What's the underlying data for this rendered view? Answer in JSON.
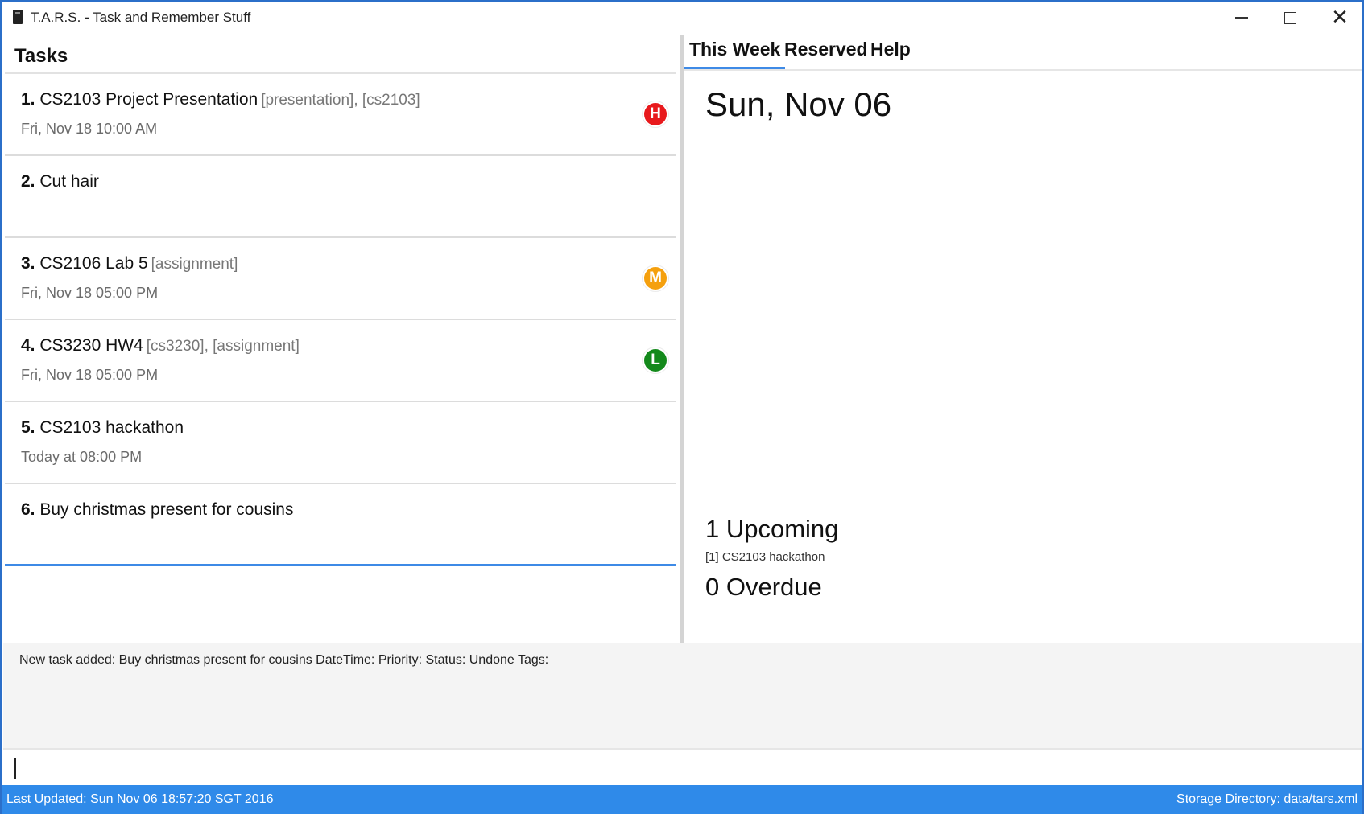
{
  "window": {
    "title": "T.A.R.S. - Task and Remember Stuff"
  },
  "tasks_panel": {
    "header": "Tasks",
    "tasks": [
      {
        "number": "1.",
        "name": "CS2103 Project Presentation",
        "tags": "[presentation], [cs2103]",
        "date": "Fri, Nov 18 10:00 AM",
        "priority": "H",
        "priority_color": "#e8191c"
      },
      {
        "number": "2.",
        "name": "Cut hair",
        "tags": "",
        "date": "",
        "priority": "",
        "priority_color": ""
      },
      {
        "number": "3.",
        "name": "CS2106 Lab 5",
        "tags": "[assignment]",
        "date": "Fri, Nov 18 05:00 PM",
        "priority": "M",
        "priority_color": "#f5a00e"
      },
      {
        "number": "4.",
        "name": "CS3230 HW4",
        "tags": "[cs3230], [assignment]",
        "date": "Fri, Nov 18 05:00 PM",
        "priority": "L",
        "priority_color": "#13891b"
      },
      {
        "number": "5.",
        "name": "CS2103 hackathon",
        "tags": "",
        "date": "Today at 08:00 PM",
        "priority": "",
        "priority_color": ""
      },
      {
        "number": "6.",
        "name": "Buy christmas present for cousins",
        "tags": "",
        "date": "",
        "priority": "",
        "priority_color": ""
      }
    ]
  },
  "right_panel": {
    "tabs": [
      {
        "label": "This Week",
        "active": true
      },
      {
        "label": "Reserved",
        "active": false
      },
      {
        "label": "Help",
        "active": false
      }
    ],
    "date_heading": "Sun, Nov 06",
    "upcoming_label": "1 Upcoming",
    "upcoming_items": [
      "[1] CS2103 hackathon"
    ],
    "overdue_label": "0 Overdue"
  },
  "result_display": {
    "text": "New task added: Buy christmas present for cousins DateTime:  Priority:  Status: Undone Tags:"
  },
  "command_box": {
    "value": "",
    "placeholder": ""
  },
  "status_bar": {
    "last_updated": "Last Updated: Sun Nov 06 18:57:20 SGT 2016",
    "storage": "Storage Directory: data/tars.xml"
  },
  "colors": {
    "accent": "#3e8ae6",
    "status_bar": "#2f8ae9",
    "window_border": "#2b6fc9",
    "priority_high": "#e8191c",
    "priority_medium": "#f5a00e",
    "priority_low": "#13891b"
  },
  "icons": {
    "app": "app-icon",
    "minimize": "minimize-icon",
    "maximize": "maximize-icon",
    "close": "close-icon"
  }
}
